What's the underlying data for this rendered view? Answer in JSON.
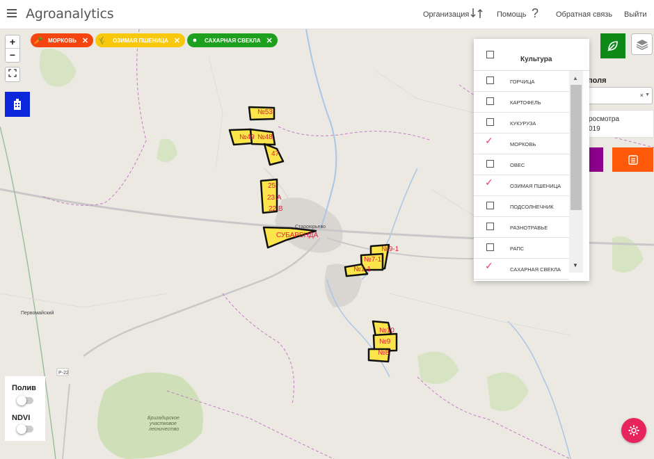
{
  "header": {
    "app_title": "Agroanalytics",
    "organization_label": "Организация",
    "help_label": "Помощь",
    "feedback_label": "Обратная связь",
    "logout_label": "Выйти"
  },
  "chips": [
    {
      "label": "МОРКОВЬ",
      "color": "#f5450e",
      "icon": "carrot-icon"
    },
    {
      "label": "ОЗИМАЯ ПШЕНИЦА",
      "color": "#f7c80c",
      "icon": "wheat-icon"
    },
    {
      "label": "САХАРНАЯ СВЕКЛА",
      "color": "#1da01d",
      "icon": "beet-icon"
    }
  ],
  "dropdown": {
    "title": "Культура",
    "items": [
      {
        "label": "ГОРЧИЦА",
        "checked": false
      },
      {
        "label": "КАРТОФЕЛЬ",
        "checked": false
      },
      {
        "label": "КУКУРУЗА",
        "checked": false
      },
      {
        "label": "МОРКОВЬ",
        "checked": true
      },
      {
        "label": "ОВЕС",
        "checked": false
      },
      {
        "label": "ОЗИМАЯ ПШЕНИЦА",
        "checked": true
      },
      {
        "label": "ПОДСОЛНЕЧНИК",
        "checked": false
      },
      {
        "label": "РАЗНОТРАВЬЕ",
        "checked": false
      },
      {
        "label": "РАПС",
        "checked": false
      },
      {
        "label": "САХАРНАЯ СВЕКЛА",
        "checked": true
      }
    ]
  },
  "side_panel": {
    "title_fragment": "поля",
    "select_clear": "×",
    "box_line1": "росмотра",
    "box_line2": "019"
  },
  "map": {
    "field_labels": [
      "№53",
      "№49",
      "№48",
      "47",
      "25",
      "23 А",
      "22 В",
      "СУБАРЕНДА",
      "№9-1",
      "№7-1",
      "№1-1",
      "№10",
      "№9",
      "№8"
    ],
    "places": {
      "town": "Староюрьево",
      "village": "Первомайский",
      "road": "Р-22",
      "forest_line1": "Бригадирское",
      "forest_line2": "участковое",
      "forest_line3": "лесничество"
    }
  },
  "toggles": {
    "irrigation_label": "Полив",
    "ndvi_label": "NDVI",
    "irrigation_on": false,
    "ndvi_on": false
  },
  "colors": {
    "field_fill": "#fbe54a",
    "field_stroke": "#111111",
    "field_label": "#e0203a",
    "check_mark": "#e8436a",
    "green_button": "#0f8a19",
    "blue_button": "#0c26d9",
    "purple_button": "#8c008c",
    "orange_button": "#ff5a0a",
    "settings_button": "#e8245c"
  }
}
